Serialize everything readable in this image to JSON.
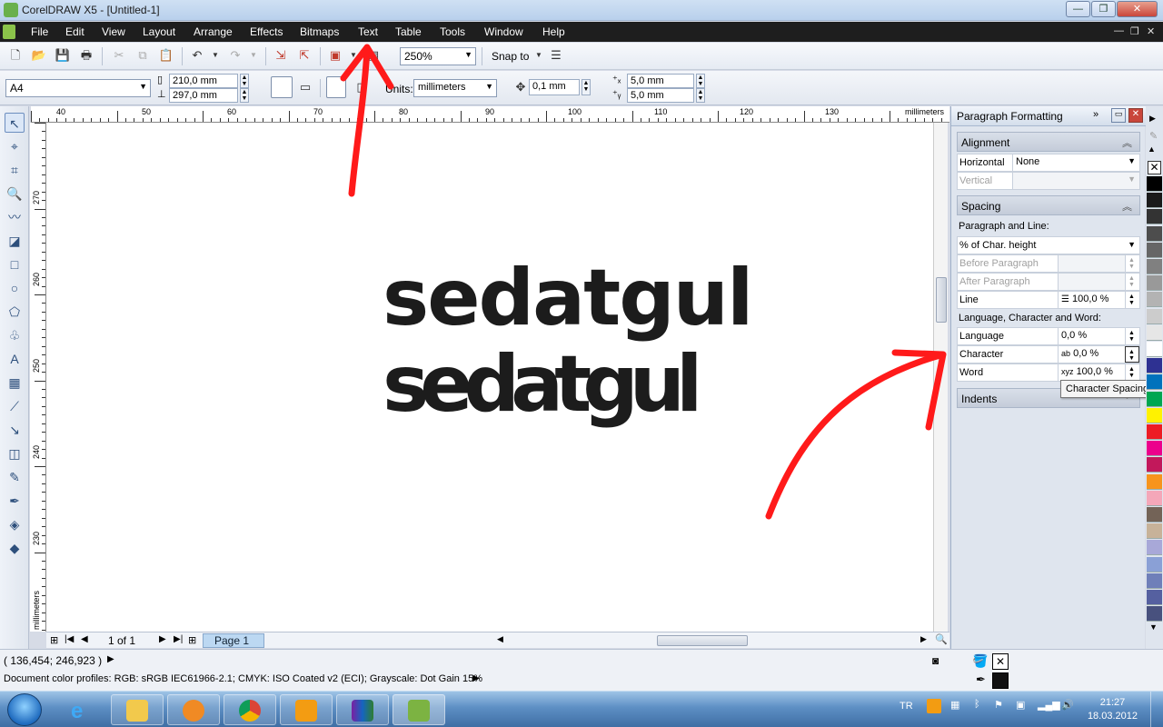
{
  "window": {
    "title": "CorelDRAW X5 - [Untitled-1]"
  },
  "menu": [
    "File",
    "Edit",
    "View",
    "Layout",
    "Arrange",
    "Effects",
    "Bitmaps",
    "Text",
    "Table",
    "Tools",
    "Window",
    "Help"
  ],
  "toolbar": {
    "zoom": "250%",
    "snap_to": "Snap to"
  },
  "property_bar": {
    "page_size": "A4",
    "width": "210,0 mm",
    "height": "297,0 mm",
    "units_label": "Units:",
    "units": "millimeters",
    "nudge": "0,1 mm",
    "dup_x": "5,0 mm",
    "dup_y": "5,0 mm"
  },
  "rulers": {
    "h_labels": [
      "40",
      "50",
      "60",
      "70",
      "80",
      "90",
      "100",
      "110",
      "120",
      "130"
    ],
    "h_unit": "millimeters",
    "v_labels": [
      "270",
      "260",
      "250",
      "240",
      "230"
    ],
    "v_unit": "millimeters"
  },
  "canvas": {
    "line1": "sedatgul",
    "line2": "sedatgul"
  },
  "page_nav": {
    "counter": "1 of 1",
    "tab": "Page 1"
  },
  "docker": {
    "title": "Paragraph Formatting",
    "alignment": {
      "header": "Alignment",
      "horizontal_label": "Horizontal",
      "horizontal_value": "None",
      "vertical_label": "Vertical"
    },
    "spacing": {
      "header": "Spacing",
      "paragraph_and_line": "Paragraph and Line:",
      "unit": "% of Char. height",
      "before_paragraph": "Before Paragraph",
      "after_paragraph": "After Paragraph",
      "line_label": "Line",
      "line_value": "100,0 %",
      "lcw_header": "Language, Character and Word:",
      "language_label": "Language",
      "language_value": "0,0 %",
      "character_label": "Character",
      "character_value": "0,0 %",
      "word_label": "Word",
      "word_value": "100,0 %"
    },
    "indents": {
      "header": "Indents"
    },
    "tooltip": "Character Spacing"
  },
  "status": {
    "coords": "( 136,454; 246,923 )",
    "profiles": "Document color profiles: RGB: sRGB IEC61966-2.1; CMYK: ISO Coated v2 (ECI); Grayscale: Dot Gain 15%"
  },
  "taskbar": {
    "language": "TR",
    "time": "21:27",
    "date": "18.03.2012"
  },
  "palette_colors": [
    "#000000",
    "#1a1a1a",
    "#333333",
    "#4d4d4d",
    "#666666",
    "#808080",
    "#999999",
    "#b3b3b3",
    "#cccccc",
    "#e6e6e6",
    "#ffffff",
    "#2e3192",
    "#0072bc",
    "#00a651",
    "#fff200",
    "#ed1c24",
    "#ec008c",
    "#c2185b",
    "#f7941d",
    "#f4a7b9",
    "#736357",
    "#c7b299",
    "#a8a8d8",
    "#8aa0d6",
    "#6f7fb9",
    "#5560a0",
    "#48517e"
  ]
}
